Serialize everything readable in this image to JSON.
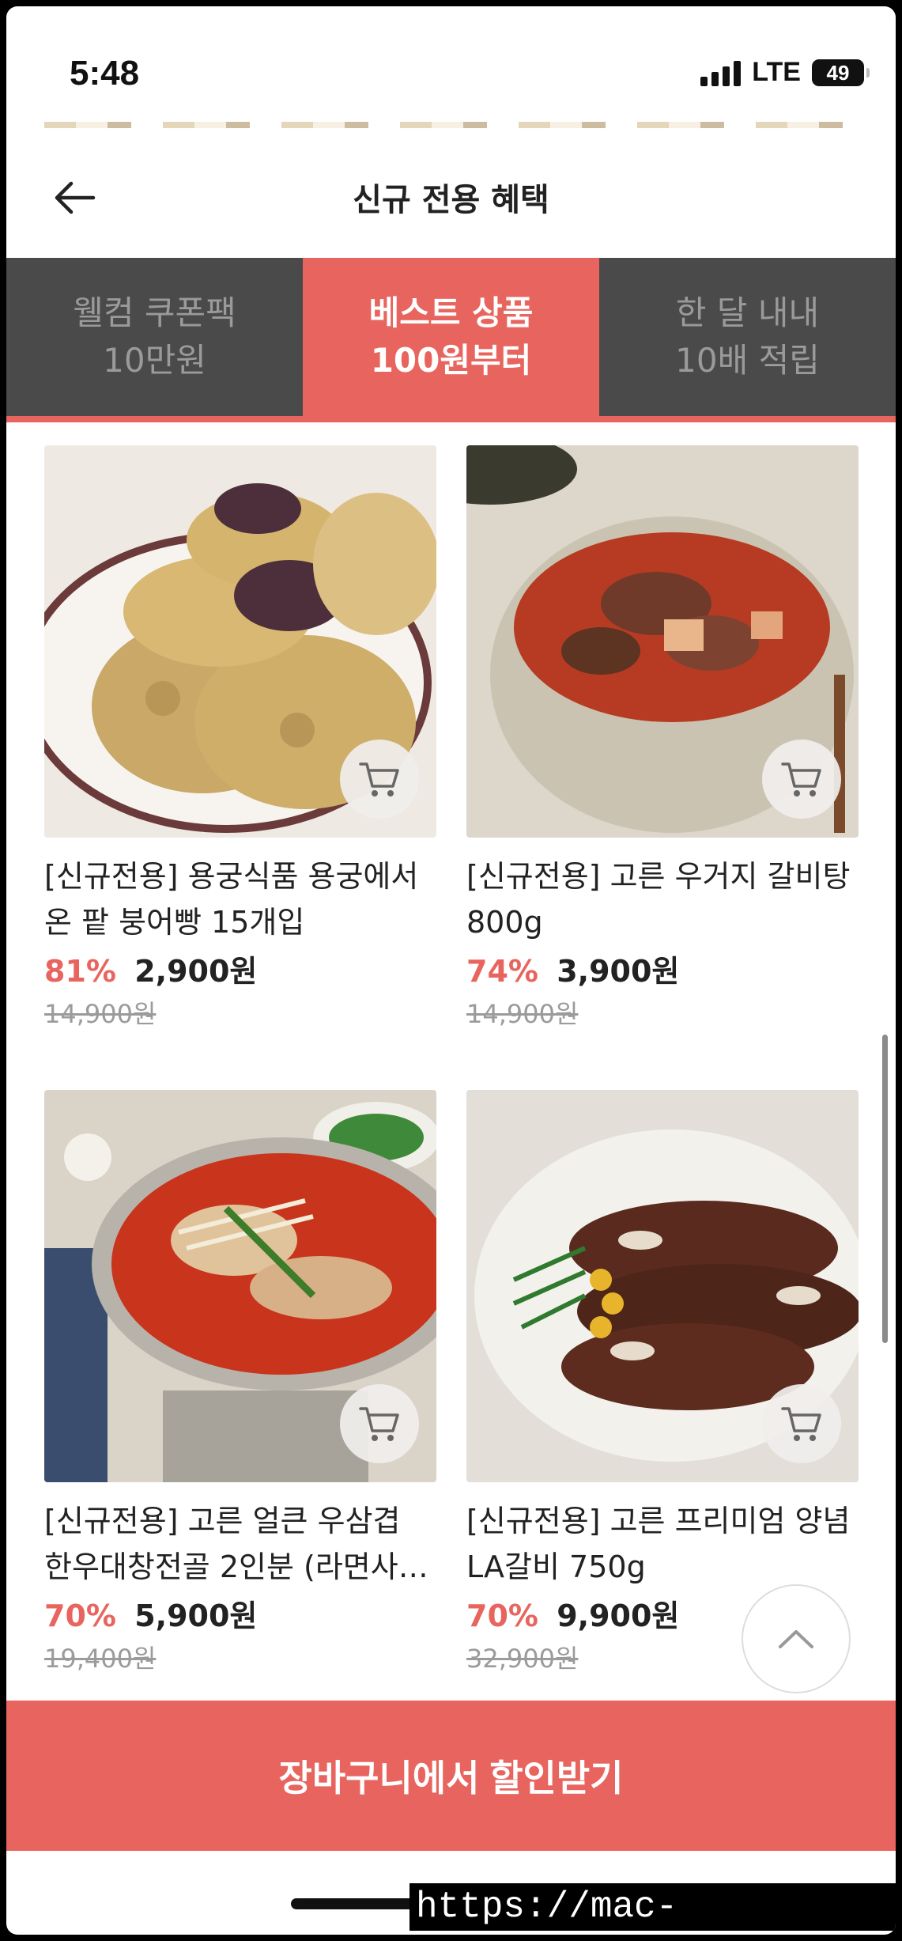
{
  "status_bar": {
    "time": "5:48",
    "network": "LTE",
    "battery": "49"
  },
  "header": {
    "title": "신규 전용 혜택",
    "back_icon": "arrow-left-icon"
  },
  "tabs": [
    {
      "line1": "웰컴 쿠폰팩",
      "line2": "10만원",
      "active": false
    },
    {
      "line1": "베스트 상품",
      "line2": "100원부터",
      "active": true
    },
    {
      "line1": "한 달 내내",
      "line2": "10배 적립",
      "active": false
    }
  ],
  "products": [
    {
      "name": "[신규전용] 용궁식품 용궁에서 온 팥 붕어빵 15개입",
      "discount": "81%",
      "price": "2,900원",
      "original": "14,900원",
      "image": "bungeoppang-photo"
    },
    {
      "name": "[신규전용] 고른 우거지 갈비탕 800g",
      "discount": "74%",
      "price": "3,900원",
      "original": "14,900원",
      "image": "galbitang-photo"
    },
    {
      "name": "[신규전용] 고른 얼큰 우삼겹 한우대창전골 2인분 (라면사…",
      "discount": "70%",
      "price": "5,900원",
      "original": "19,400원",
      "image": "jeongol-photo"
    },
    {
      "name": "[신규전용] 고른 프리미엄 양념 LA갈비 750g",
      "discount": "70%",
      "price": "9,900원",
      "original": "32,900원",
      "image": "la-galbi-photo"
    }
  ],
  "cart_icon": "cart-icon",
  "scroll_top_icon": "chevron-up-icon",
  "cta": {
    "label": "장바구니에서 할인받기"
  },
  "watermark": "https://mac-os.tistory.com",
  "colors": {
    "accent": "#e8655f",
    "tab_inactive": "#4a4a4a"
  }
}
